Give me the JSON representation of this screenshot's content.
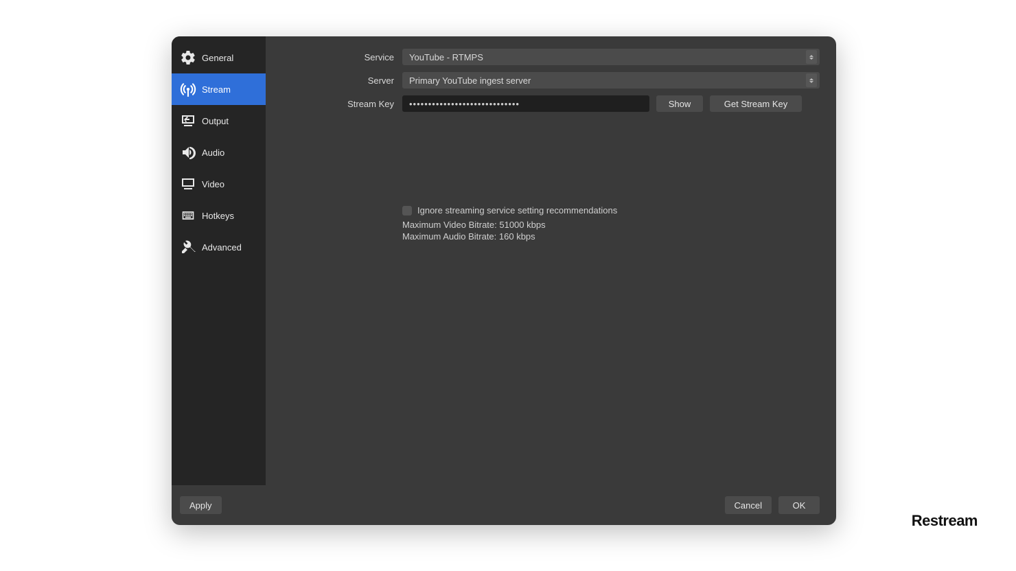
{
  "sidebar": {
    "items": [
      {
        "label": "General"
      },
      {
        "label": "Stream"
      },
      {
        "label": "Output"
      },
      {
        "label": "Audio"
      },
      {
        "label": "Video"
      },
      {
        "label": "Hotkeys"
      },
      {
        "label": "Advanced"
      }
    ],
    "active_index": 1
  },
  "form": {
    "service_label": "Service",
    "service_value": "YouTube - RTMPS",
    "server_label": "Server",
    "server_value": "Primary YouTube ingest server",
    "streamkey_label": "Stream Key",
    "streamkey_value": "•••••••••••••••••••••••••••••",
    "show_button": "Show",
    "get_stream_key_button": "Get Stream Key"
  },
  "info": {
    "ignore_recommendations_label": "Ignore streaming service setting recommendations",
    "ignore_recommendations_checked": false,
    "max_video_bitrate": "Maximum Video Bitrate: 51000 kbps",
    "max_audio_bitrate": "Maximum Audio Bitrate: 160 kbps"
  },
  "footer": {
    "apply": "Apply",
    "cancel": "Cancel",
    "ok": "OK"
  },
  "watermark": "Restream"
}
